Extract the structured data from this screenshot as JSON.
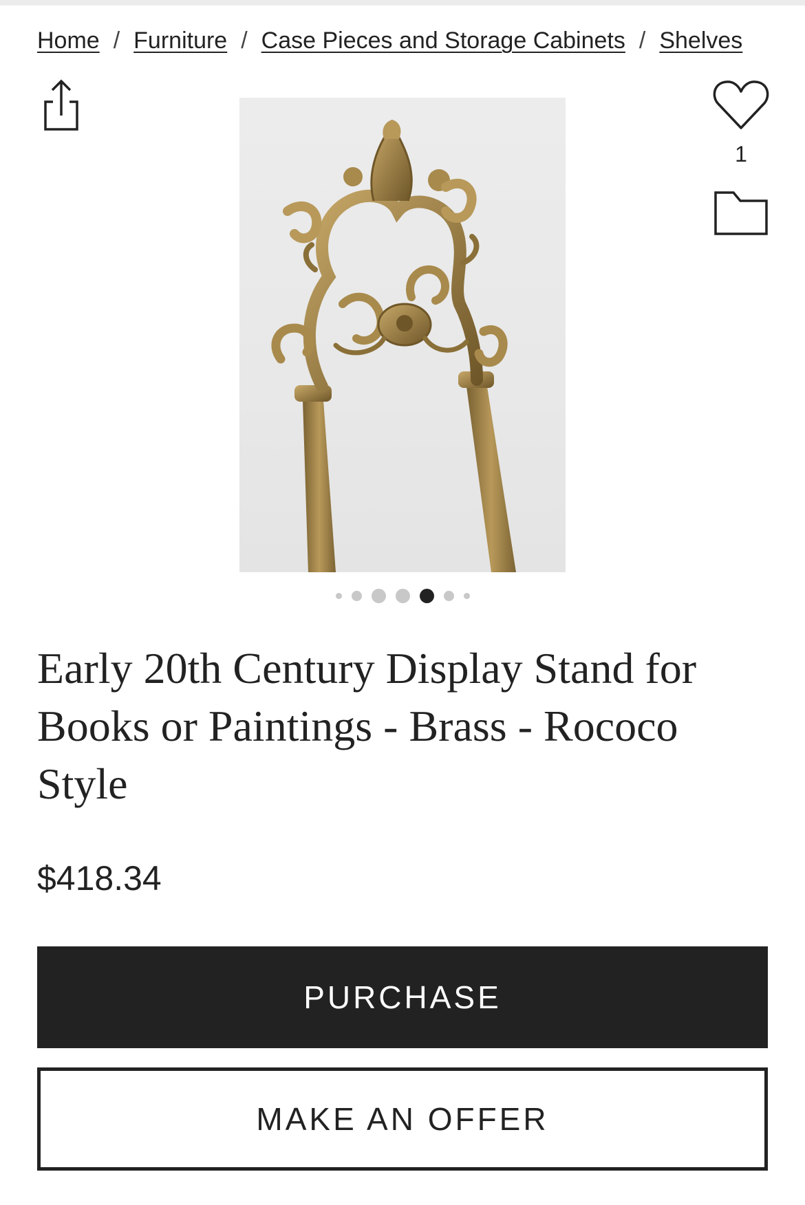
{
  "breadcrumb": {
    "items": [
      {
        "label": "Home"
      },
      {
        "label": "Furniture"
      },
      {
        "label": "Case Pieces and Storage Cabinets"
      },
      {
        "label": "Shelves"
      }
    ],
    "separator": "/"
  },
  "actions": {
    "share_icon": "share-icon",
    "favorite_icon": "heart-icon",
    "favorite_count": "1",
    "folder_icon": "folder-icon"
  },
  "gallery": {
    "image_subject": "ornate brass rococo display easel",
    "image_count": 7,
    "active_index": 4
  },
  "product": {
    "title": "Early 20th Century Display Stand for Books or Paintings - Brass - Rococo Style",
    "price": "$418.34"
  },
  "buttons": {
    "purchase": "PURCHASE",
    "make_offer": "MAKE AN OFFER"
  },
  "colors": {
    "primary": "#222222",
    "background": "#ffffff",
    "brass": "#a88a4c",
    "dot_inactive": "#c8c8c8"
  }
}
